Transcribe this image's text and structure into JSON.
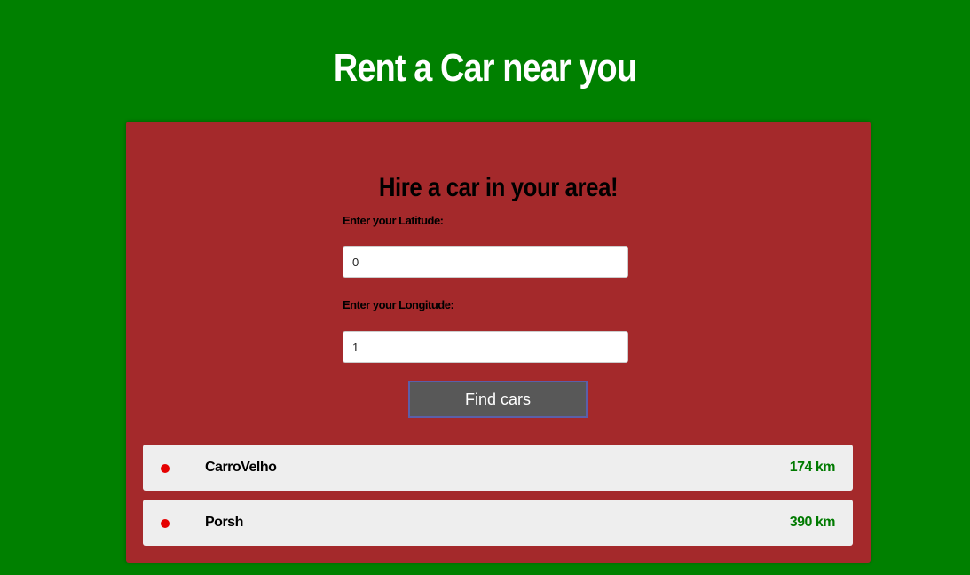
{
  "header": {
    "title": "Rent a Car near you"
  },
  "form": {
    "title": "Hire a car in your area!",
    "latitude_label": "Enter your Latitude:",
    "latitude_value": "0",
    "longitude_label": "Enter your Longitude:",
    "longitude_value": "1",
    "button_label": "Find cars"
  },
  "results": [
    {
      "name": "CarroVelho",
      "distance": "174 km"
    },
    {
      "name": "Porsh",
      "distance": "390 km"
    }
  ],
  "colors": {
    "background": "#008000",
    "panel": "#a4292b",
    "row": "#eeeeee",
    "dot": "#e50000",
    "distance": "#007a00",
    "button": "#585858"
  }
}
